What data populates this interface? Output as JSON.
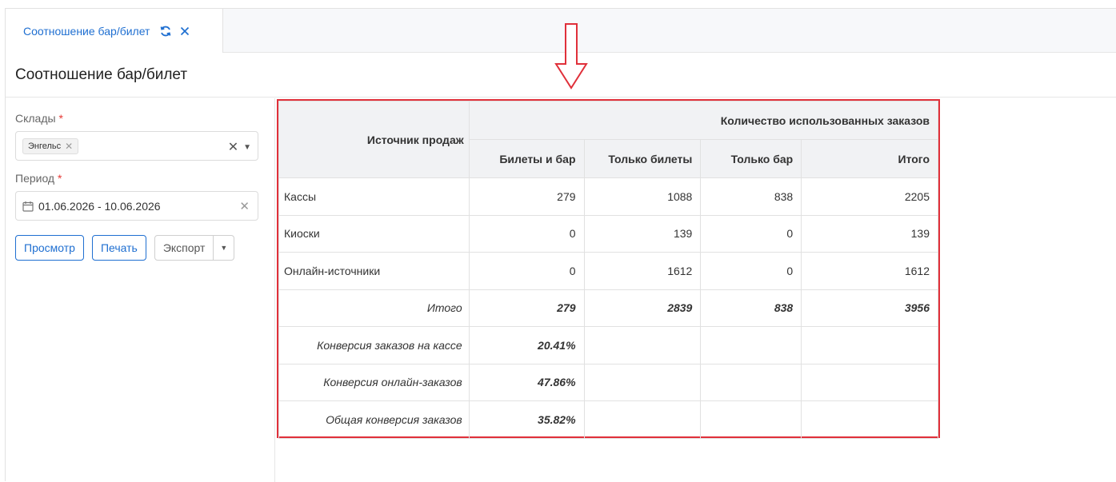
{
  "tab": {
    "label": "Соотношение бар/билет"
  },
  "page_title": "Соотношение бар/билет",
  "filters": {
    "warehouses": {
      "label": "Склады",
      "required_mark": "*",
      "chips": [
        "Энгельс"
      ]
    },
    "period": {
      "label": "Период",
      "required_mark": "*",
      "value": "01.06.2026 - 10.06.2026"
    }
  },
  "buttons": {
    "view": "Просмотр",
    "print": "Печать",
    "export": "Экспорт"
  },
  "colors": {
    "accent": "#1f6fd1",
    "highlight_border": "#e0303a",
    "required": "#e53935"
  },
  "report": {
    "source_header": "Источник продаж",
    "group_header": "Количество использованных заказов",
    "columns": [
      "Билеты и бар",
      "Только билеты",
      "Только бар",
      "Итого"
    ],
    "rows": [
      {
        "label": "Кассы",
        "values": [
          "279",
          "1088",
          "838",
          "2205"
        ]
      },
      {
        "label": "Киоски",
        "values": [
          "0",
          "139",
          "0",
          "139"
        ]
      },
      {
        "label": "Онлайн-источники",
        "values": [
          "0",
          "1612",
          "0",
          "1612"
        ]
      }
    ],
    "total": {
      "label": "Итого",
      "values": [
        "279",
        "2839",
        "838",
        "3956"
      ]
    },
    "conversions": [
      {
        "label": "Конверсия заказов на кассе",
        "value": "20.41%"
      },
      {
        "label": "Конверсия онлайн-заказов",
        "value": "47.86%"
      },
      {
        "label": "Общая конверсия заказов",
        "value": "35.82%"
      }
    ]
  }
}
